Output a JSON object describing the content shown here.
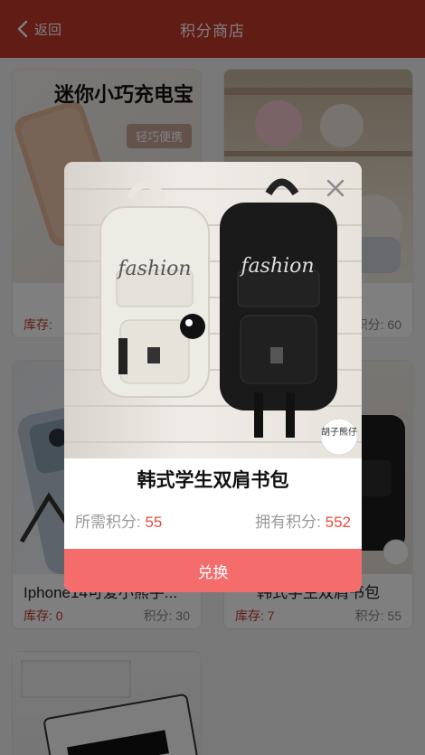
{
  "header": {
    "back_label": "返回",
    "title": "积分商店"
  },
  "products": [
    {
      "name": "",
      "stock_label": "库存:",
      "stock": "",
      "points_label": "",
      "points": "",
      "image_text": "迷你小巧充电宝",
      "image_tag": "轻巧便携"
    },
    {
      "name": "",
      "stock_label": "",
      "stock": "",
      "points_label": "积分:",
      "points": "60"
    },
    {
      "name": "Iphone14可爱小熊手...",
      "stock_label": "库存:",
      "stock": "0",
      "points_label": "积分:",
      "points": "30"
    },
    {
      "name": "韩式学生双肩书包",
      "stock_label": "库存:",
      "stock": "7",
      "points_label": "积分:",
      "points": "55"
    },
    {
      "name": ""
    }
  ],
  "modal": {
    "title": "韩式学生双肩书包",
    "need_label": "所需积分:",
    "need_points": "55",
    "have_label": "拥有积分:",
    "have_points": "552",
    "exchange_label": "兑换",
    "bag_text_left": "fashion",
    "bag_text_right": "fashion",
    "logo_text": "胡子熊仔"
  },
  "colors": {
    "header": "#c0392b",
    "accent": "#e74c3c",
    "button": "#f56c6c"
  }
}
